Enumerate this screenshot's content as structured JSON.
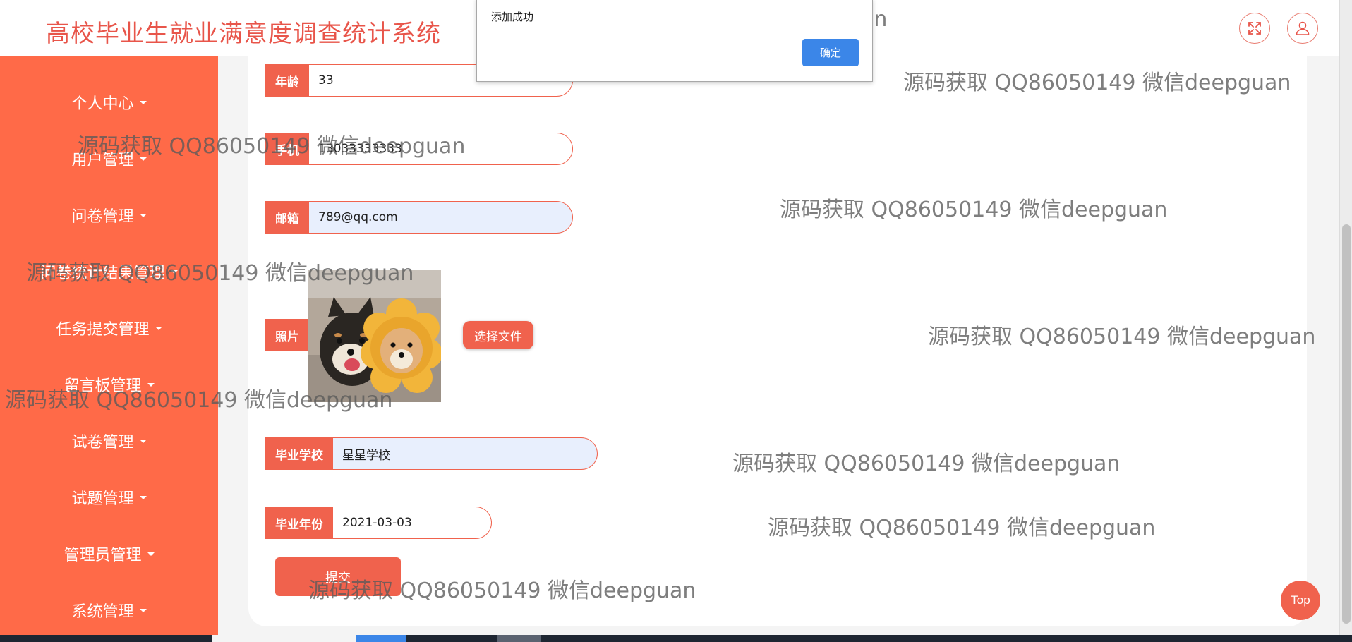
{
  "app": {
    "title": "高校毕业生就业满意度调查统计系统"
  },
  "header": {
    "fullscreen_icon": "expand-icon",
    "user_icon": "user-icon"
  },
  "sidebar": {
    "items": [
      {
        "label": "个人中心"
      },
      {
        "label": "用户管理"
      },
      {
        "label": "问卷管理"
      },
      {
        "label": "问卷统计结果管理"
      },
      {
        "label": "任务提交管理"
      },
      {
        "label": "留言板管理"
      },
      {
        "label": "试卷管理"
      },
      {
        "label": "试题管理"
      },
      {
        "label": "管理员管理"
      },
      {
        "label": "系统管理"
      }
    ]
  },
  "form": {
    "age": {
      "label": "年龄",
      "value": "33"
    },
    "phone": {
      "label": "手机",
      "value": "13033333333"
    },
    "email": {
      "label": "邮箱",
      "value": "789@qq.com"
    },
    "photo": {
      "label": "照片",
      "choose_label": "选择文件"
    },
    "school": {
      "label": "毕业学校",
      "value": "星星学校"
    },
    "grad_year": {
      "label": "毕业年份",
      "value": "2021-03-03"
    },
    "submit_label": "提交"
  },
  "alert": {
    "message": "添加成功",
    "ok_label": "确定"
  },
  "watermark": "源码获取 QQ86050149 微信deepguan",
  "top_button": {
    "label": "Top"
  },
  "colors": {
    "accent": "#f0624d",
    "sidebar": "#ff6a48",
    "title": "#e8554a",
    "dialog_button": "#3b86e8"
  }
}
